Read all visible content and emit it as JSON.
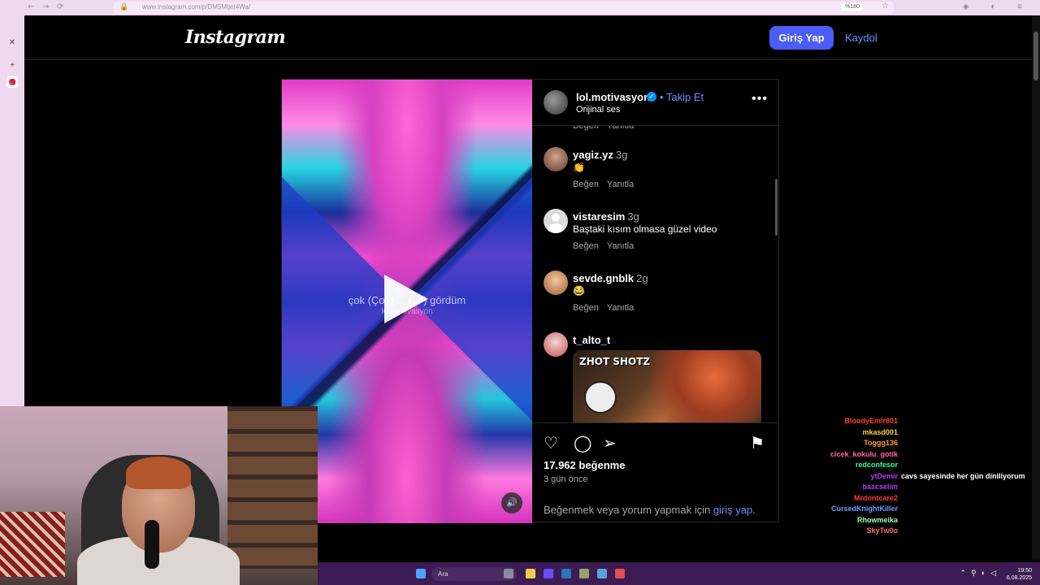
{
  "browser": {
    "url": "www.instagram.com/p/DM5Mtjet4Wa/",
    "zoom": "%180"
  },
  "header": {
    "logo": "Instagram",
    "login_label": "Giriş Yap",
    "signup_label": "Kaydol"
  },
  "video": {
    "caption": "çok (Çok) ... (... ) gördüm",
    "sub": "lol.motivasyon"
  },
  "post": {
    "author": "lol.motivasyon",
    "follow_label": "• Takip Et",
    "audio": "Orijinal ses",
    "likes": "17.962 beğenme",
    "time_ago": "3 gün önce",
    "login_prompt": "Beğenmek veya yorum yapmak için",
    "login_link": "giriş yap",
    "login_suffix": "."
  },
  "comment_actions": {
    "like": "Beğen",
    "reply": "Yanıtla"
  },
  "comments": [
    {
      "user": "yagiz.yz",
      "time": "3g",
      "text": "👏"
    },
    {
      "user": "vistaresim",
      "time": "3g",
      "text": "Baştaki kısım olmasa güzel video"
    },
    {
      "user": "sevde.gnblk",
      "time": "2g",
      "text": "😂"
    },
    {
      "user": "t_alto_t",
      "time": "",
      "text": "",
      "image_label": "ZHOT SHOTZ"
    }
  ],
  "chat": [
    {
      "user": "BloodyEmir801",
      "color": "#ff3b3b",
      "msg": ""
    },
    {
      "user": "mkasd001",
      "color": "#ffd23b",
      "msg": ""
    },
    {
      "user": "Toggg136",
      "color": "#ff9b3b",
      "msg": ""
    },
    {
      "user": "cicek_kokulu_gotik",
      "color": "#ff6b9b",
      "msg": ""
    },
    {
      "user": "redconfesor",
      "color": "#3bff9b",
      "msg": ""
    },
    {
      "user": "ytDemir",
      "color": "#b43bff",
      "msg": "cavs sayesinde her gün diniliyorum"
    },
    {
      "user": "bascselim",
      "color": "#b43bff",
      "msg": ""
    },
    {
      "user": "Mrdontcare2",
      "color": "#ff3b3b",
      "msg": ""
    },
    {
      "user": "CursedKnightKiller",
      "color": "#6b9bff",
      "msg": ""
    },
    {
      "user": "Rhowmeika",
      "color": "#9bffb4",
      "msg": ""
    },
    {
      "user": "SkyTw0o",
      "color": "#ff6b6b",
      "msg": ""
    }
  ],
  "taskbar": {
    "search_placeholder": "Ara",
    "time": "19:50",
    "date": "6.08.2025"
  }
}
